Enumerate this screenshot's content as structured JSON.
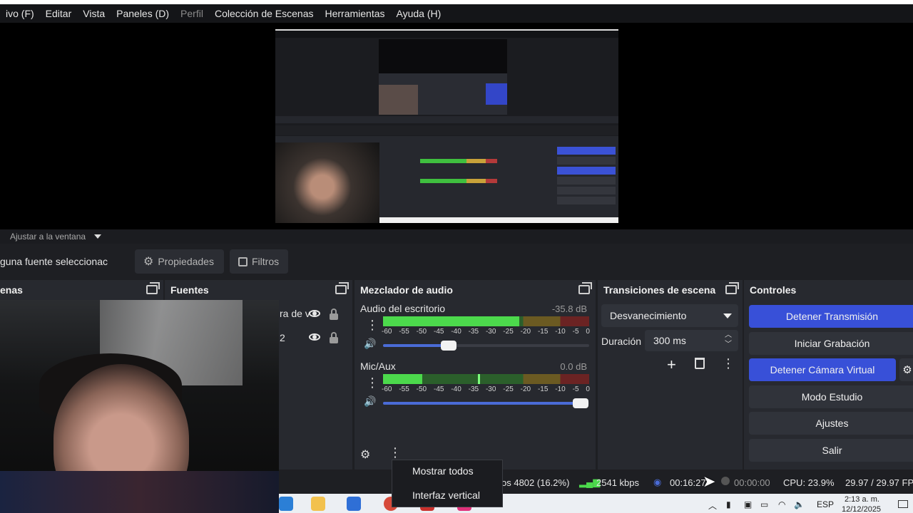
{
  "menubar": {
    "items": [
      {
        "label": "ivo (F)",
        "disabled": false
      },
      {
        "label": "Editar",
        "disabled": false
      },
      {
        "label": "Vista",
        "disabled": false
      },
      {
        "label": "Paneles (D)",
        "disabled": false
      },
      {
        "label": "Perfil",
        "disabled": true
      },
      {
        "label": "Colección de Escenas",
        "disabled": false
      },
      {
        "label": "Herramientas",
        "disabled": false
      },
      {
        "label": "Ayuda (H)",
        "disabled": false
      }
    ]
  },
  "preview_toolbar": {
    "scale_label": "Ajustar a la ventana"
  },
  "properties_bar": {
    "no_source": "guna fuente seleccionac",
    "properties_label": "Propiedades",
    "filters_label": "Filtros"
  },
  "docks": {
    "scenes": {
      "title": "enas"
    },
    "sources": {
      "title": "Fuentes",
      "rows": [
        {
          "label": "ra de v"
        },
        {
          "label": "2"
        }
      ]
    },
    "mixer": {
      "title": "Mezclador de audio",
      "channels": [
        {
          "name": "Audio del escritorio",
          "db": "-35.8 dB",
          "level_fraction": 0.66,
          "peak_fraction": 0.0,
          "volume_fraction": 0.32
        },
        {
          "name": "Mic/Aux",
          "db": "0.0 dB",
          "level_fraction": 0.19,
          "peak_fraction": 0.46,
          "volume_fraction": 0.96
        }
      ],
      "scale_ticks": [
        "-60",
        "-55",
        "-50",
        "-45",
        "-40",
        "-35",
        "-30",
        "-25",
        "-20",
        "-15",
        "-10",
        "-5",
        "0"
      ]
    },
    "transitions": {
      "title": "Transiciones de escena",
      "transition_value": "Desvanecimiento",
      "duration_label": "Duración",
      "duration_value": "300 ms"
    },
    "controls": {
      "title": "Controles",
      "buttons": [
        {
          "label": "Detener Transmisión",
          "accent": true
        },
        {
          "label": "Iniciar Grabación",
          "accent": false
        },
        {
          "label": "Detener Cámara Virtual",
          "accent": true
        },
        {
          "label": "Modo Estudio",
          "accent": false
        },
        {
          "label": "Ajustes",
          "accent": false
        },
        {
          "label": "Salir",
          "accent": false
        }
      ]
    }
  },
  "context_menu": {
    "items": [
      "Mostrar todos",
      "Interfaz vertical"
    ]
  },
  "statusbar": {
    "dropped_frames": "os 4802 (16.2%)",
    "bitrate": "2541 kbps",
    "stream_time": "00:16:27",
    "rec_time": "00:00:00",
    "cpu": "CPU: 23.9%",
    "fps": "29.97 / 29.97 FP"
  },
  "taskbar": {
    "lang": "ESP",
    "clock_time": "2:13 a. m.",
    "clock_date": "12/12/2025"
  },
  "colors": {
    "accent": "#3850d8",
    "meter_green": "#4cd94c",
    "panel": "#27292f"
  }
}
